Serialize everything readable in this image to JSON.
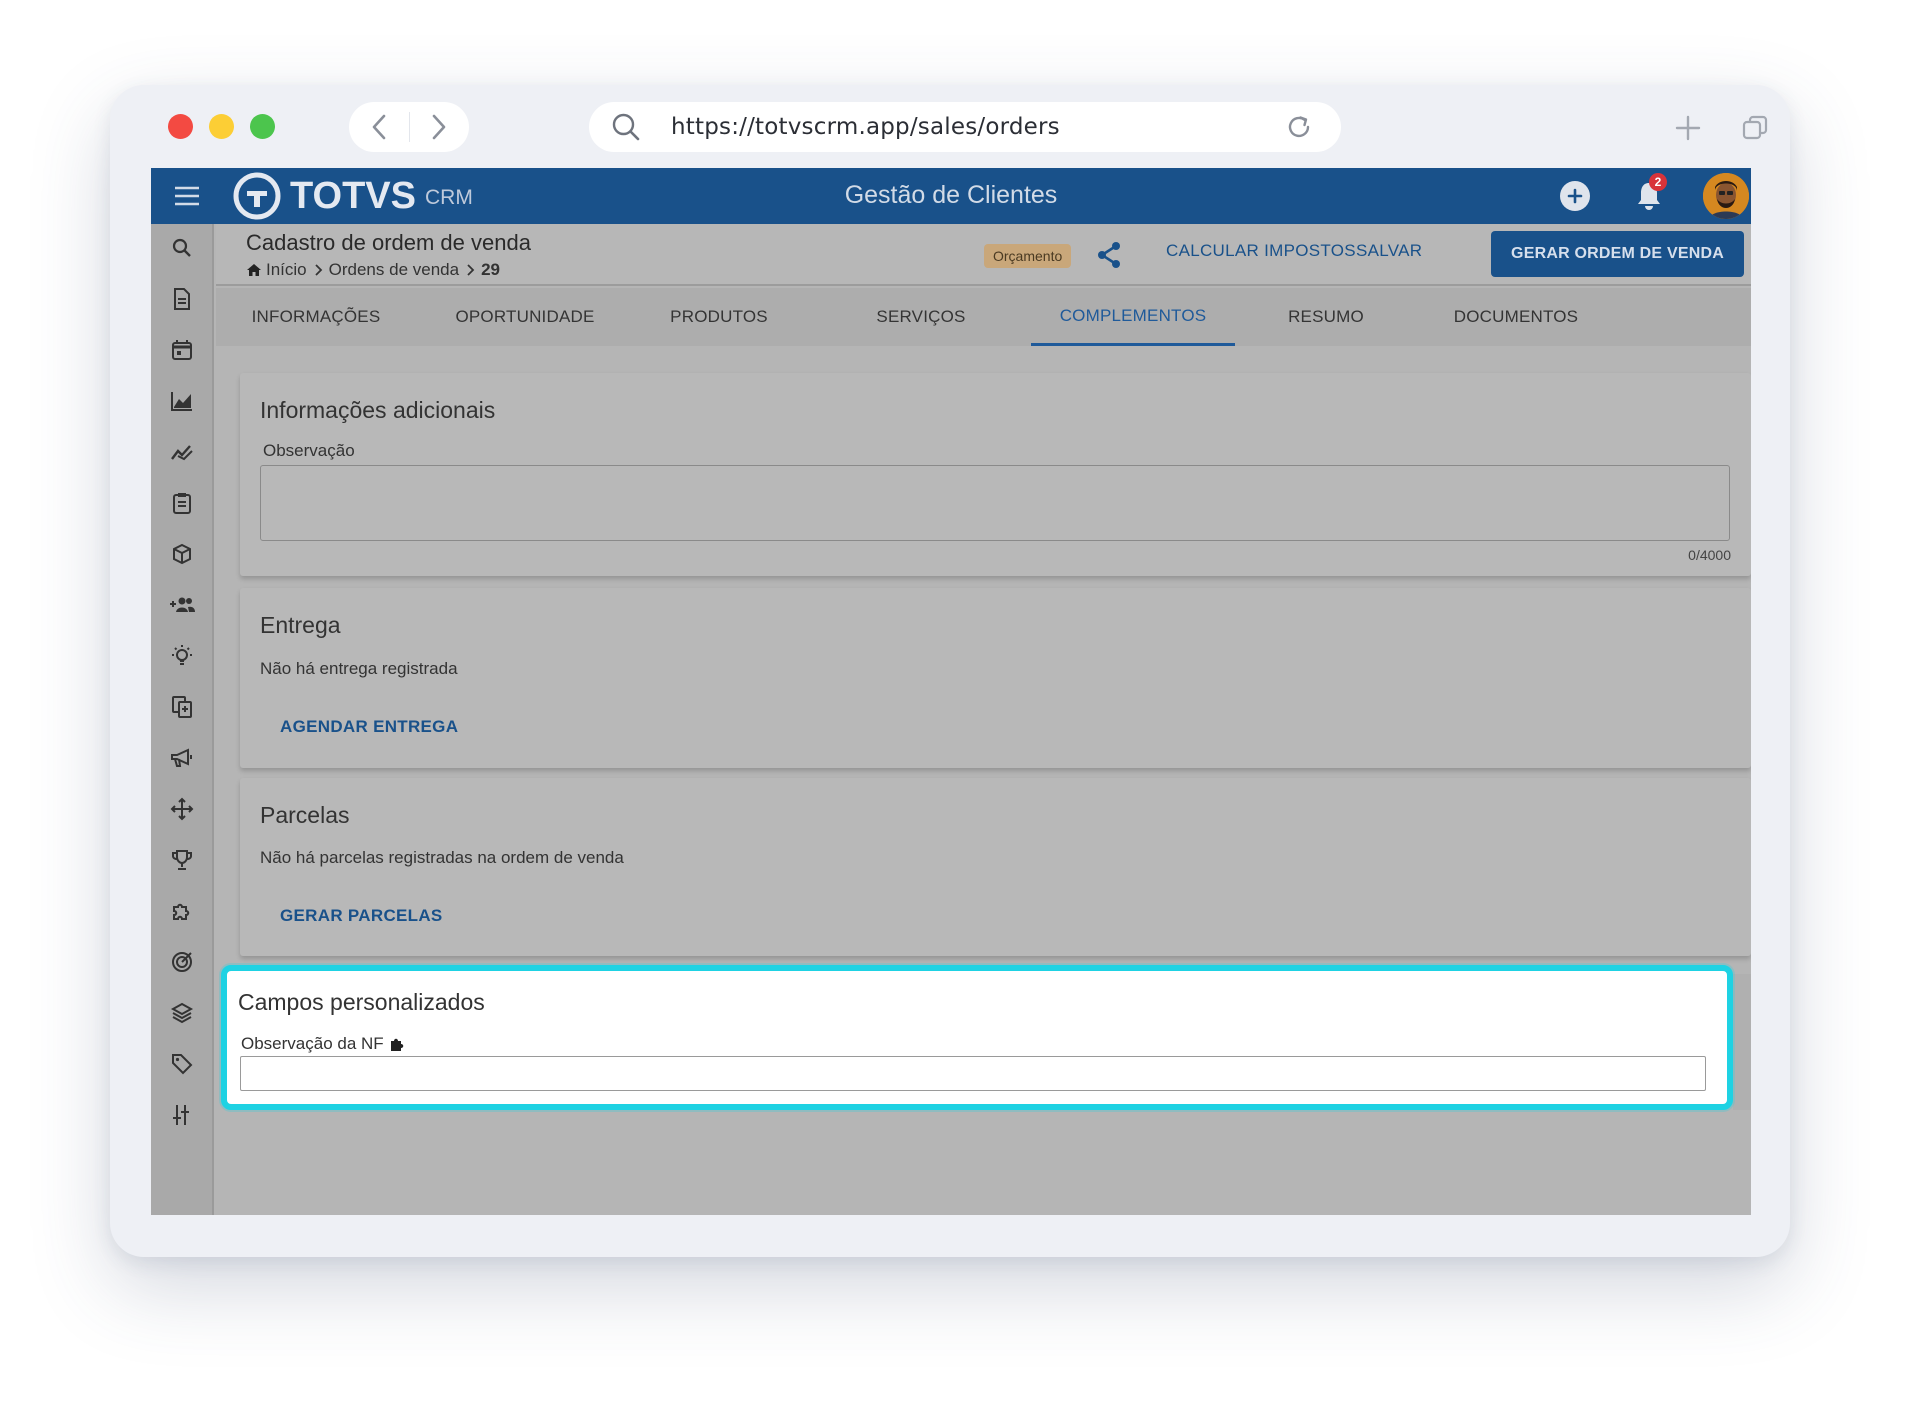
{
  "browser": {
    "url": "https://totvscrm.app/sales/orders"
  },
  "app": {
    "brand": "TOTVS",
    "brand_sub": "CRM",
    "title": "Gestão de Clientes",
    "notification_count": "2"
  },
  "sidebar": {
    "items": [
      "search-icon",
      "document-icon",
      "calendar-icon",
      "area-chart-icon",
      "trend-icon",
      "clipboard-icon",
      "box-icon",
      "add-group-icon",
      "lightbulb-icon",
      "copy-icon",
      "megaphone-icon",
      "move-icon",
      "trophy-icon",
      "puzzle-icon",
      "target-icon",
      "layers-icon",
      "tag-icon",
      "settings-sliders-icon"
    ]
  },
  "header": {
    "page_title": "Cadastro de ordem de venda",
    "breadcrumb": {
      "home": "Início",
      "orders": "Ordens de venda",
      "current": "29"
    },
    "status": "Orçamento",
    "calc_taxes": "CALCULAR IMPOSTOS",
    "save": "SALVAR",
    "generate_order": "GERAR ORDEM DE VENDA"
  },
  "tabs": [
    {
      "label": "INFORMAÇÕES"
    },
    {
      "label": "OPORTUNIDADE"
    },
    {
      "label": "PRODUTOS"
    },
    {
      "label": "SERVIÇOS"
    },
    {
      "label": "COMPLEMENTOS",
      "active": true
    },
    {
      "label": "RESUMO"
    },
    {
      "label": "DOCUMENTOS"
    }
  ],
  "additional_info": {
    "title": "Informações adicionais",
    "observation_label": "Observação",
    "observation_value": "",
    "counter": "0/4000"
  },
  "delivery": {
    "title": "Entrega",
    "empty_text": "Não há entrega registrada",
    "action": "AGENDAR ENTREGA"
  },
  "installments": {
    "title": "Parcelas",
    "empty_text": "Não há parcelas registradas na ordem de venda",
    "action": "GERAR PARCELAS"
  },
  "custom_fields": {
    "title": "Campos personalizados",
    "nf_label": "Observação da NF",
    "nf_value": ""
  },
  "colors": {
    "primary": "#19518a",
    "highlight": "#1ed2e3",
    "overlay_gray": "#b5b5b5"
  }
}
